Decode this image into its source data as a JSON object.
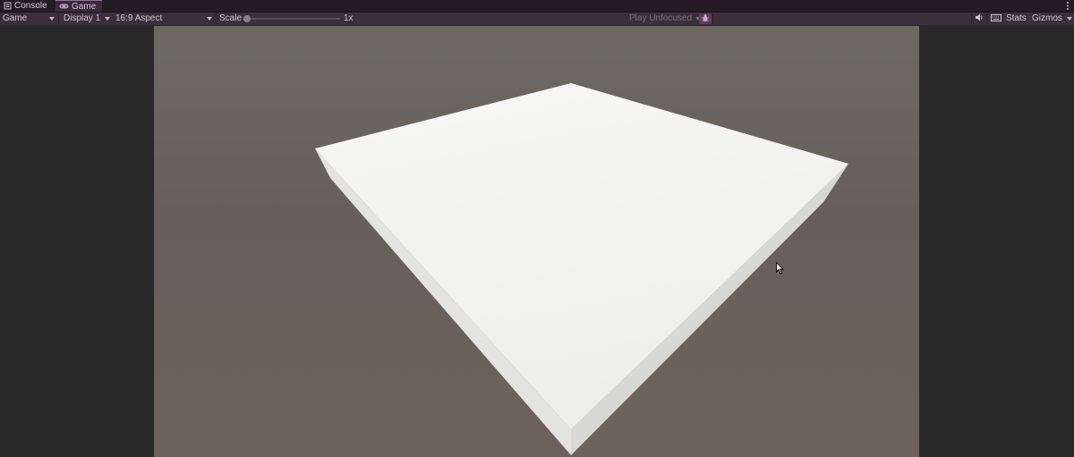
{
  "tabs": [
    {
      "label": "Console",
      "icon": "console-icon",
      "active": false
    },
    {
      "label": "Game",
      "icon": "gamepad-icon",
      "active": true
    }
  ],
  "toolbar": {
    "view_mode": "Game",
    "display": "Display 1",
    "aspect": "16:9 Aspect",
    "scale_label": "Scale",
    "scale_value": "1x",
    "play_focus": "Play Unfocused",
    "stats_label": "Stats",
    "gizmos_label": "Gizmos"
  },
  "colors": {
    "tab_bar": "#241b24",
    "toolbar": "#3c2e3c",
    "accent": "#9a6aa0",
    "viewport_bg": "#6a645d",
    "editor_bg": "#282828",
    "plane_top": "#f2f2f0",
    "plane_side_left": "#e4e4e0",
    "plane_side_right": "#d9dad6"
  },
  "scene": {
    "object": "white cube platform"
  }
}
